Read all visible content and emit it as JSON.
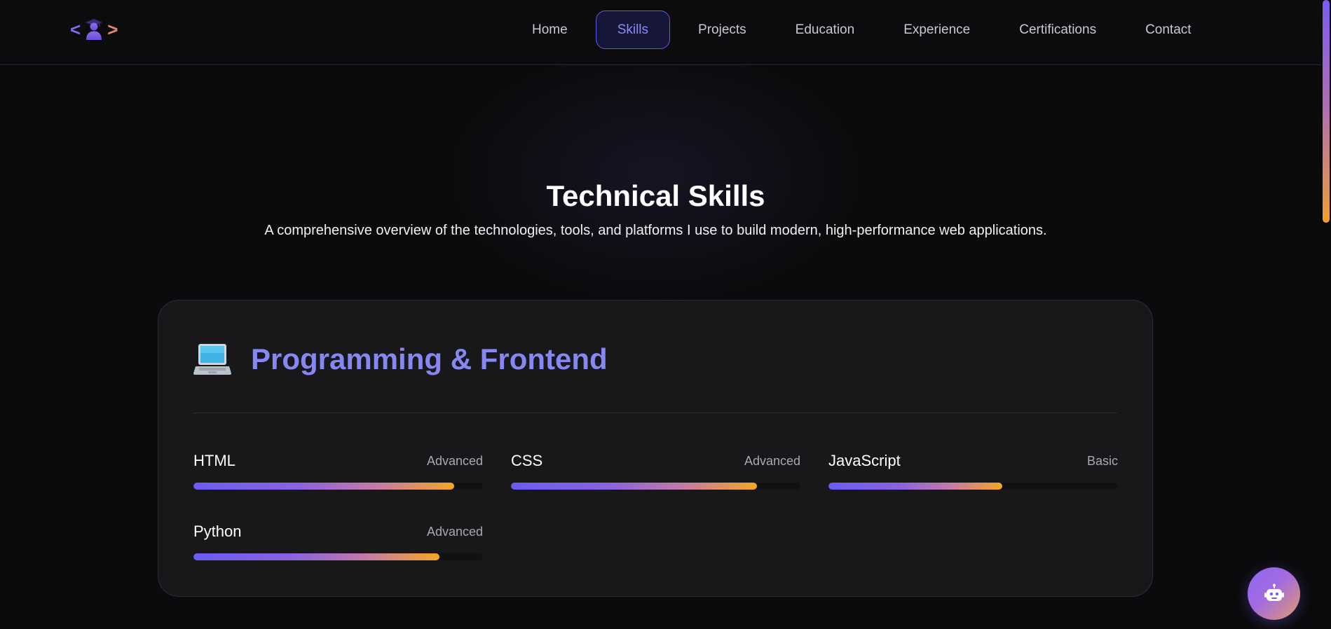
{
  "logo": {
    "left_bracket": "<",
    "right_bracket": ">",
    "icon": "student-graduate-icon"
  },
  "nav": {
    "items": [
      {
        "label": "Home",
        "active": false
      },
      {
        "label": "Skills",
        "active": true
      },
      {
        "label": "Projects",
        "active": false
      },
      {
        "label": "Education",
        "active": false
      },
      {
        "label": "Experience",
        "active": false
      },
      {
        "label": "Certifications",
        "active": false
      },
      {
        "label": "Contact",
        "active": false
      }
    ]
  },
  "section": {
    "title": "Technical Skills",
    "subtitle": "A comprehensive overview of the technologies, tools, and platforms I use to build modern, high-performance web applications."
  },
  "card": {
    "icon": "laptop-icon",
    "title": "Programming & Frontend",
    "skills": [
      {
        "name": "HTML",
        "level": "Advanced",
        "progress": 0.9
      },
      {
        "name": "CSS",
        "level": "Advanced",
        "progress": 0.85
      },
      {
        "name": "JavaScript",
        "level": "Basic",
        "progress": 0.6
      },
      {
        "name": "Python",
        "level": "Advanced",
        "progress": 0.85
      }
    ]
  },
  "chat": {
    "icon": "robot-icon"
  },
  "colors": {
    "accent": "#8587f2",
    "gradient_start": "#6a5cf2",
    "gradient_end": "#f5a623",
    "background": "#0b0b0d",
    "card": "#18181b"
  }
}
